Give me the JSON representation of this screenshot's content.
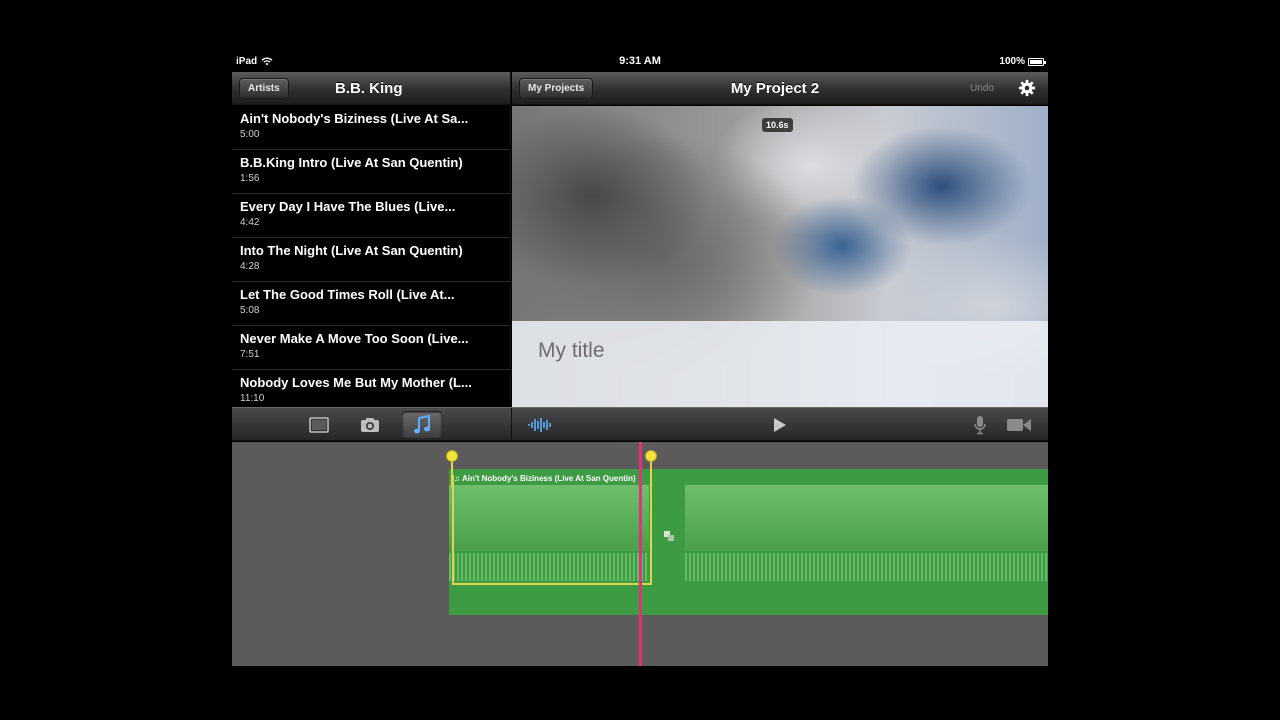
{
  "status": {
    "device": "iPad",
    "time": "9:31 AM",
    "battery": "100%"
  },
  "left_nav": {
    "back_button": "Artists",
    "title": "B.B. King"
  },
  "right_nav": {
    "back_button": "My Projects",
    "title": "My Project 2",
    "undo": "Undo"
  },
  "songs": [
    {
      "title": "Ain't Nobody's Biziness (Live At Sa...",
      "duration": "5:00"
    },
    {
      "title": "B.B.King Intro (Live At San Quentin)",
      "duration": "1:56"
    },
    {
      "title": "Every Day I Have The Blues (Live...",
      "duration": "4:42"
    },
    {
      "title": "Into The Night (Live At San Quentin)",
      "duration": "4:28"
    },
    {
      "title": "Let The Good Times Roll (Live At...",
      "duration": "5:08"
    },
    {
      "title": "Never Make A Move Too Soon (Live...",
      "duration": "7:51"
    },
    {
      "title": "Nobody Loves Me But My Mother (L...",
      "duration": "11:10"
    }
  ],
  "viewer": {
    "duration_badge": "10.6s",
    "title_text": "My title"
  },
  "timeline": {
    "clip_label": "Ain't Nobody's Biziness (Live At San Quentin)"
  },
  "colors": {
    "accent": "#3a8ee6",
    "playhead": "#e1327a",
    "clip_green": "#3d9c43",
    "handle": "#f5e23a"
  }
}
